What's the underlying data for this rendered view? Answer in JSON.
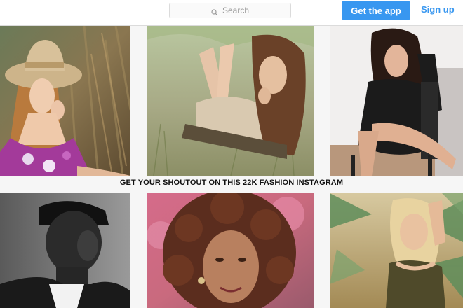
{
  "header": {
    "search": {
      "placeholder": "Search",
      "icon": "search-icon"
    },
    "get_app_label": "Get the app",
    "signup_label": "Sign up",
    "accent_color": "#3897f0"
  },
  "banner": {
    "text": "GET YOUR SHOUTOUT ON THIS 22K FASHION INSTAGRAM"
  },
  "grid": {
    "photos": [
      {
        "subject": "woman-straw-hat"
      },
      {
        "subject": "woman-lying-grass"
      },
      {
        "subject": "woman-black-dress-chair"
      },
      {
        "subject": "man-bw-portrait"
      },
      {
        "subject": "woman-curly-hair"
      },
      {
        "subject": "woman-blonde-palms"
      }
    ]
  }
}
